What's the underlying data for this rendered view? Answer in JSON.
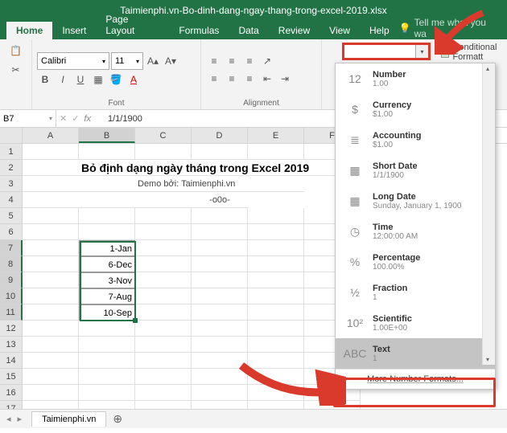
{
  "titlebar": "Taimienphi.vn-Bo-dinh-dang-ngay-thang-trong-excel-2019.xlsx",
  "tabs": [
    "Home",
    "Insert",
    "Page Layout",
    "Formulas",
    "Data",
    "Review",
    "View",
    "Help"
  ],
  "tellme": "Tell me what you wa",
  "font": {
    "name": "Calibri",
    "size": "11",
    "group_font": "Font",
    "group_align": "Alignment"
  },
  "cond_format_label": "Conditional Formatt",
  "namebox": "B7",
  "formula": "1/1/1900",
  "cols": [
    "A",
    "B",
    "C",
    "D",
    "E",
    "F"
  ],
  "content": {
    "title": "Bỏ định dạng ngày tháng trong Excel 2019",
    "sub1": "Demo bởi: Taimienphi.vn",
    "sub2": "-o0o-"
  },
  "data_cells": [
    "1-Jan",
    "6-Dec",
    "3-Nov",
    "7-Aug",
    "10-Sep"
  ],
  "sheet": "Taimienphi.vn",
  "numfmt": [
    {
      "icon": "12",
      "name": "Number",
      "sample": "1.00"
    },
    {
      "icon": "$",
      "name": "Currency",
      "sample": "$1.00"
    },
    {
      "icon": "≣",
      "name": "Accounting",
      "sample": "$1.00"
    },
    {
      "icon": "▦",
      "name": "Short Date",
      "sample": "1/1/1900"
    },
    {
      "icon": "▦",
      "name": "Long Date",
      "sample": "Sunday, January 1, 1900"
    },
    {
      "icon": "◷",
      "name": "Time",
      "sample": "12:00:00 AM"
    },
    {
      "icon": "%",
      "name": "Percentage",
      "sample": "100.00%"
    },
    {
      "icon": "½",
      "name": "Fraction",
      "sample": "1"
    },
    {
      "icon": "10²",
      "name": "Scientific",
      "sample": "1.00E+00"
    },
    {
      "icon": "ABC",
      "name": "Text",
      "sample": "1"
    }
  ],
  "more_formats": "More Number Formats..."
}
